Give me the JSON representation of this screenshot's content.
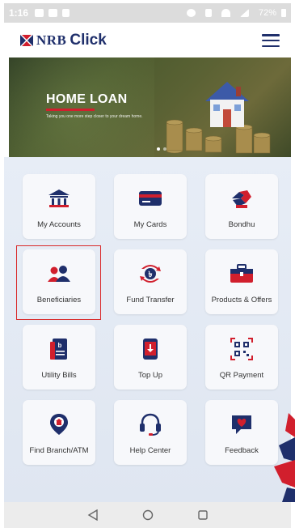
{
  "status_bar": {
    "time": "1:16",
    "battery": "72%"
  },
  "header": {
    "logo_bank": "NRB",
    "logo_app": "Click",
    "menu_icon": "hamburger-menu-icon"
  },
  "banner": {
    "title": "HOME LOAN",
    "subtitle": "Taking you one more step closer to your dream home.",
    "slide_count": 2,
    "active_slide": 1
  },
  "tiles": [
    {
      "label": "My Accounts",
      "icon": "bank-building-icon"
    },
    {
      "label": "My Cards",
      "icon": "credit-card-icon"
    },
    {
      "label": "Bondhu",
      "icon": "handshake-icon"
    },
    {
      "label": "Beneficiaries",
      "icon": "users-icon"
    },
    {
      "label": "Fund Transfer",
      "icon": "transfer-icon"
    },
    {
      "label": "Products & Offers",
      "icon": "briefcase-icon"
    },
    {
      "label": "Utility Bills",
      "icon": "bill-icon"
    },
    {
      "label": "Top Up",
      "icon": "phone-topup-icon"
    },
    {
      "label": "QR Payment",
      "icon": "qr-code-icon"
    },
    {
      "label": "Find Branch/ATM",
      "icon": "location-pin-icon"
    },
    {
      "label": "Help Center",
      "icon": "headset-icon"
    },
    {
      "label": "Feedback",
      "icon": "feedback-heart-icon"
    }
  ],
  "colors": {
    "brand_blue": "#1f2f6b",
    "brand_red": "#d11f2d",
    "highlight_border": "#d92a2a"
  },
  "nav": {
    "back": "back-triangle-icon",
    "home": "home-circle-icon",
    "recents": "recents-square-icon"
  }
}
